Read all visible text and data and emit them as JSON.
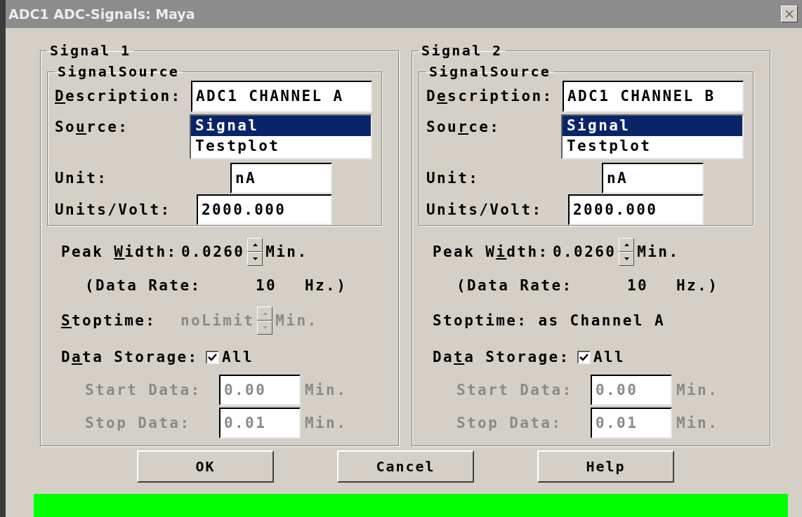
{
  "window": {
    "title": "ADC1 ADC-Signals: Maya"
  },
  "signals": [
    {
      "title": "Signal 1",
      "source_group": {
        "title": "SignalSource",
        "description": {
          "label": {
            "key": "D",
            "after": "escription:"
          },
          "value": "ADC1 CHANNEL A"
        },
        "source": {
          "label": {
            "before": "So",
            "key": "u",
            "after": "rce:"
          },
          "options": [
            {
              "label": "Signal",
              "selected": true
            },
            {
              "label": "Testplot",
              "selected": false
            }
          ]
        },
        "unit": {
          "label": "Unit:",
          "value": "nA"
        },
        "units_per_volt": {
          "label": "Units/Volt:",
          "value": "2000.000"
        }
      },
      "peak_width": {
        "label": {
          "before": "Peak ",
          "key": "W",
          "after": "idth:"
        },
        "value": "0.0260",
        "unit": "Min."
      },
      "data_rate": {
        "label": "(Data Rate:",
        "value": "10",
        "unit": "Hz.)"
      },
      "stoptime": {
        "kind": "spinner",
        "label": {
          "key": "S",
          "after": "toptime:"
        },
        "value": "noLimit",
        "unit": "Min.",
        "disabled": true
      },
      "data_storage": {
        "label": {
          "before": "D",
          "key": "a",
          "after": "ta Storage:"
        },
        "checkbox": {
          "label": "All",
          "checked": true
        }
      },
      "start_data": {
        "label": "Start Data:",
        "value": "0.00",
        "unit": "Min.",
        "disabled": true
      },
      "stop_data": {
        "label": "Stop Data:",
        "value": "0.01",
        "unit": "Min.",
        "disabled": true
      }
    },
    {
      "title": "Signal 2",
      "source_group": {
        "title": "SignalSource",
        "description": {
          "label": {
            "before": "D",
            "key": "e",
            "after": "scription:"
          },
          "value": "ADC1 CHANNEL B"
        },
        "source": {
          "label": {
            "before": "Sou",
            "key": "r",
            "after": "ce:"
          },
          "options": [
            {
              "label": "Signal",
              "selected": true
            },
            {
              "label": "Testplot",
              "selected": false
            }
          ]
        },
        "unit": {
          "label": "Unit:",
          "value": "nA"
        },
        "units_per_volt": {
          "label": "Units/Volt:",
          "value": "2000.000"
        }
      },
      "peak_width": {
        "label": {
          "before": "Peak W",
          "key": "i",
          "after": "dth:"
        },
        "value": "0.0260",
        "unit": "Min."
      },
      "data_rate": {
        "label": "(Data Rate:",
        "value": "10",
        "unit": "Hz.)"
      },
      "stoptime": {
        "kind": "text",
        "label": "Stoptime: as Channel A"
      },
      "data_storage": {
        "label": {
          "before": "Da",
          "key": "t",
          "after": "a Storage:"
        },
        "checkbox": {
          "label": "All",
          "checked": true
        }
      },
      "start_data": {
        "label": "Start Data:",
        "value": "0.00",
        "unit": "Min.",
        "disabled": true
      },
      "stop_data": {
        "label": "Stop Data:",
        "value": "0.01",
        "unit": "Min.",
        "disabled": true
      }
    }
  ],
  "buttons": [
    {
      "label": "OK"
    },
    {
      "label": "Cancel"
    },
    {
      "label": "Help"
    }
  ]
}
